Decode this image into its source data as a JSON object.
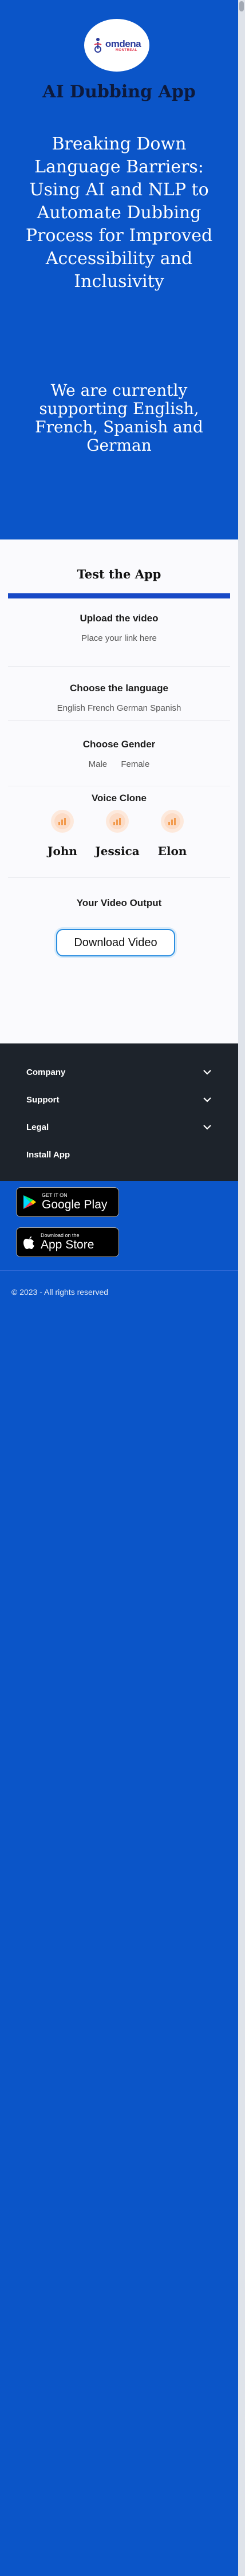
{
  "logo": {
    "main": "omdena",
    "sub": "MONTREAL"
  },
  "hero": {
    "app_title": "AI Dubbing App",
    "heading": "Breaking Down Language Barriers: Using AI and NLP to Automate Dubbing Process for Improved Accessibility and Inclusivity",
    "languages_note": "We are currently supporting English, French, Spanish and German"
  },
  "test_app": {
    "title": "Test the App",
    "upload": {
      "title": "Upload the video",
      "placeholder": "Place your link here"
    },
    "language": {
      "title": "Choose the language",
      "options_text": "English French German Spanish"
    },
    "gender": {
      "title": "Choose Gender",
      "options": [
        "Male",
        "Female"
      ]
    },
    "voice_clone": {
      "title": "Voice Clone",
      "voices": [
        "John",
        "Jessica",
        "Elon"
      ]
    },
    "output": {
      "title": "Your Video Output",
      "download_label": "Download Video"
    }
  },
  "footer": {
    "items": [
      "Company",
      "Support",
      "Legal",
      "Install App"
    ],
    "google_play": {
      "small": "GET IT ON",
      "big": "Google Play"
    },
    "app_store": {
      "small": "Download on the",
      "big": "App Store"
    },
    "copyright": "© 2023 - All rights reserved"
  },
  "colors": {
    "brand_blue": "#0b55c8",
    "accent_bar": "#1849c6",
    "footer_dark": "#1d232b",
    "voice_badge": "#fde9dc"
  }
}
